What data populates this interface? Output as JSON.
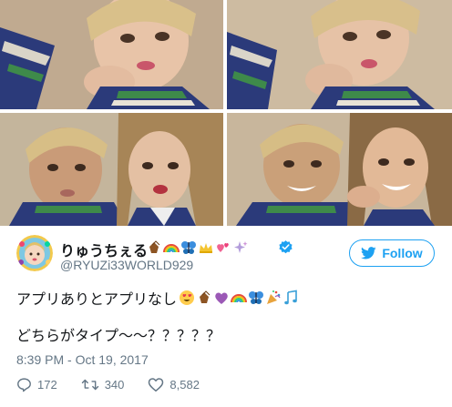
{
  "photos": [
    {
      "label": "photo-1"
    },
    {
      "label": "photo-2"
    },
    {
      "label": "photo-3"
    },
    {
      "label": "photo-4"
    }
  ],
  "author": {
    "display_name": "りゅうちぇる",
    "screen_name": "@RYUZi33WORLD929",
    "name_emojis": [
      "clapping-hands-icon",
      "rainbow-icon",
      "butterfly-icon",
      "crown-icon",
      "hearts-icon",
      "sparkles-icon"
    ],
    "verified_icon": "verified-badge-icon"
  },
  "follow_button": {
    "label": "Follow",
    "icon": "twitter-bird-icon",
    "color": "#1da1f2"
  },
  "tweet": {
    "line1": "アプリありとアプリなし",
    "line1_emojis": [
      "heart-eyes-icon",
      "clapping-hands-icon",
      "purple-heart-icon",
      "rainbow-icon",
      "butterfly-icon",
      "party-popper-icon",
      "musical-notes-icon"
    ],
    "line2": "どちらがタイプ〜〜？？？？？",
    "timestamp": "8:39 PM - Oct 19, 2017"
  },
  "actions": {
    "reply_count": "172",
    "retweet_count": "340",
    "like_count": "8,582"
  },
  "colors": {
    "text_primary": "#14171a",
    "text_secondary": "#657786",
    "brand": "#1da1f2"
  }
}
